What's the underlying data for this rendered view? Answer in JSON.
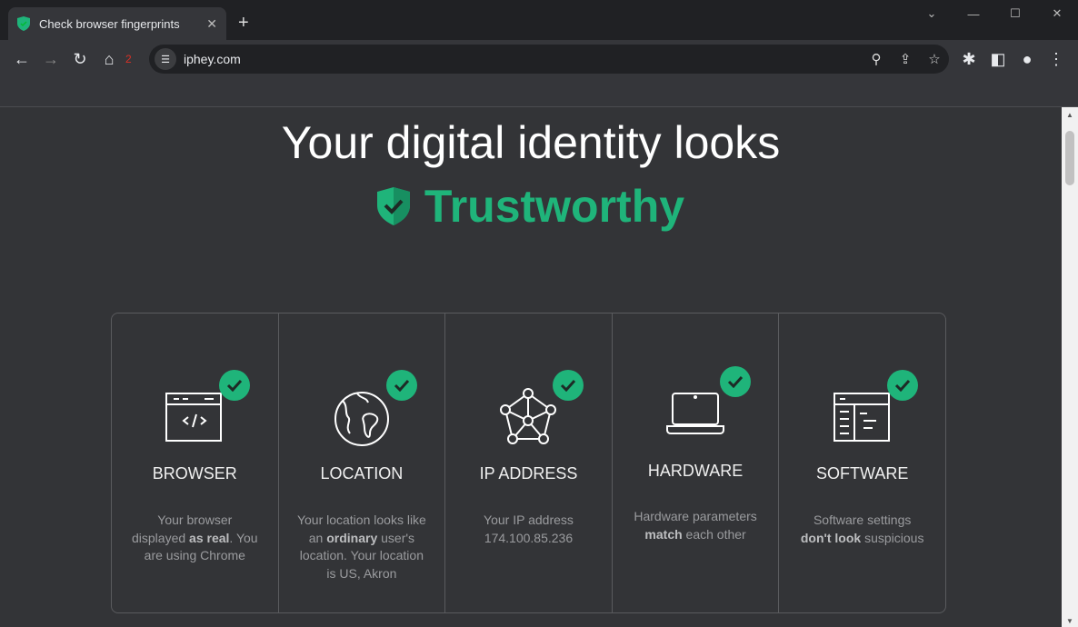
{
  "browser": {
    "tab_title": "Check browser fingerprints",
    "url": "iphey.com",
    "extension_badge": "2"
  },
  "page": {
    "headline": "Your digital identity looks",
    "verdict": "Trustworthy",
    "accent": "#1fb47a",
    "cards": [
      {
        "name": "BROWSER",
        "icon": "browser-code-icon",
        "pre": "Your browser displayed ",
        "bold": "as real",
        "post": ". You are using Chrome"
      },
      {
        "name": "LOCATION",
        "icon": "globe-icon",
        "pre": "Your location looks like an ",
        "bold": "ordinary",
        "post": " user's location. Your location is US, Akron"
      },
      {
        "name": "IP ADDRESS",
        "icon": "network-icon",
        "pre": "Your IP address 174.100.85.236",
        "bold": "",
        "post": ""
      },
      {
        "name": "HARDWARE",
        "icon": "laptop-icon",
        "pre": "Hardware parameters ",
        "bold": "match",
        "post": " each other"
      },
      {
        "name": "SOFTWARE",
        "icon": "software-window-icon",
        "pre": "Software settings ",
        "bold": "don't look",
        "post": " suspicious"
      }
    ]
  }
}
